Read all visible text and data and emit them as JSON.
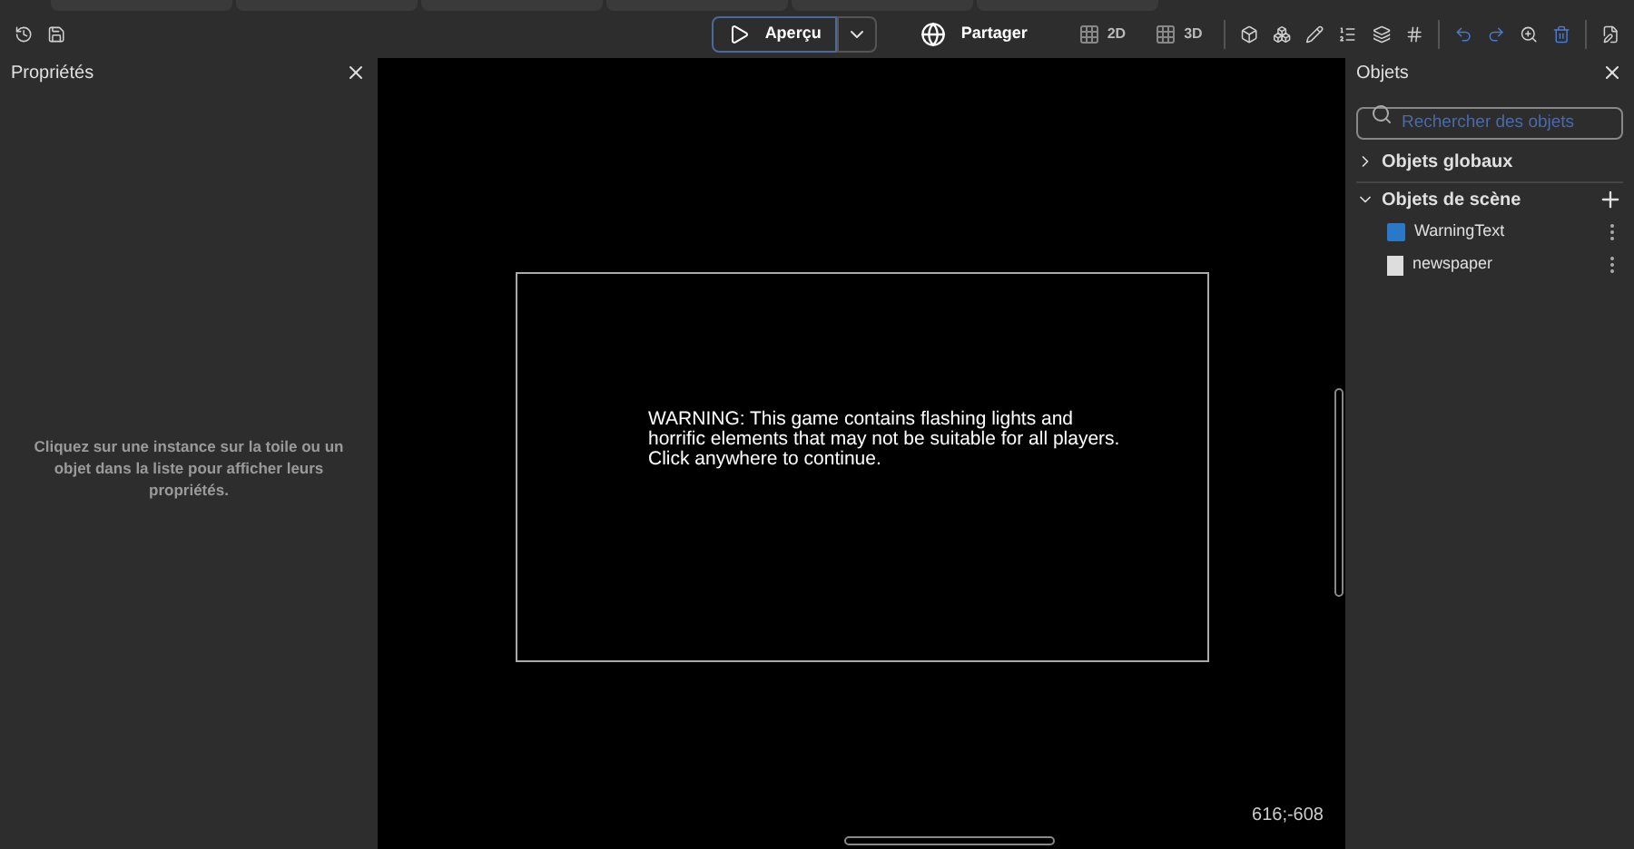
{
  "toolbar": {
    "preview_button": "Aperçu",
    "share_button": "Partager",
    "view_modes": [
      {
        "label": "2D"
      },
      {
        "label": "3D"
      }
    ]
  },
  "properties_panel": {
    "title": "Propriétés",
    "empty_message": "Cliquez sur une instance sur la toile ou un objet dans la liste pour afficher leurs propriétés."
  },
  "canvas": {
    "warning_text": "WARNING: This game contains flashing lights and horrific elements that may not be suitable for all players. Click anywhere to continue.",
    "coordinates": "616;-608"
  },
  "objects_panel": {
    "title": "Objets",
    "search": {
      "placeholder": "Rechercher des objets"
    },
    "groups": [
      {
        "label": "Objets globaux",
        "expanded": false
      },
      {
        "label": "Objets de scène",
        "expanded": true,
        "children": [
          {
            "label": "WarningText",
            "kind": "text"
          },
          {
            "label": "newspaper",
            "kind": "sprite"
          }
        ]
      }
    ]
  }
}
